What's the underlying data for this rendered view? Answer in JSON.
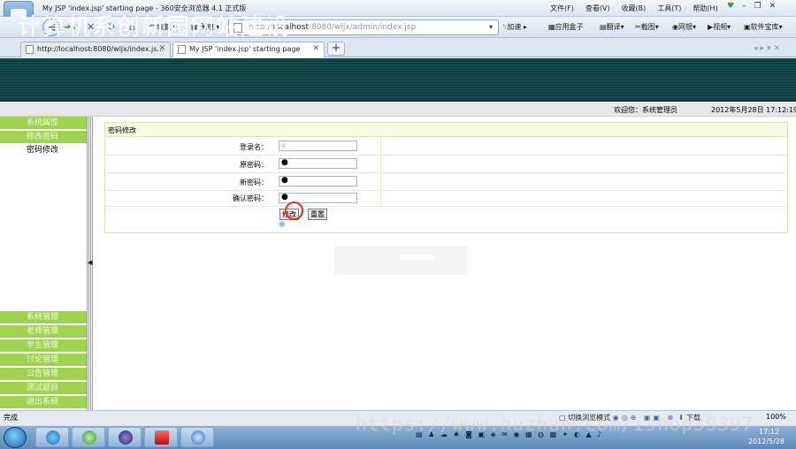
{
  "window": {
    "title": "My JSP 'index.jsp' starting page - 360安全浏览器 4.1 正式版",
    "menus": [
      "文件(F)",
      "查看(V)",
      "收藏(B)",
      "工具(T)",
      "帮助(H)"
    ],
    "controls": [
      "♥",
      "–",
      "❐",
      "✕"
    ]
  },
  "toolbar": {
    "back_icon": "back-arrow-icon",
    "forward_icon": "forward-arrow-icon",
    "restore_label": "恢复",
    "trace_label": "无痕",
    "address": {
      "prefix": "http://",
      "host": "localhost",
      "rest": ":8080/wljx/admin/index.jsp"
    },
    "speedup_label": "加速",
    "extensions": [
      "应用盒子",
      "翻译",
      "截图",
      "网银",
      "视频",
      "软件宝库"
    ]
  },
  "tabs": [
    {
      "label": "http://localhost:8080/wljx/index.js...",
      "active": false
    },
    {
      "label": "My JSP 'index.jsp' starting page",
      "active": true
    }
  ],
  "site": {
    "title": "计算机系创新园网站建设",
    "welcome": "欢迎您：系统管理员",
    "datetime": "2012年5月28日   17:12:19"
  },
  "sidebar": {
    "top_items": [
      {
        "label": "系统属性",
        "style": "green"
      },
      {
        "label": "修改密码",
        "style": "green"
      },
      {
        "label": "密码修改",
        "style": "plain"
      }
    ],
    "bottom_items": [
      {
        "label": "系统管理"
      },
      {
        "label": "老师管理"
      },
      {
        "label": "学生管理"
      },
      {
        "label": "讨论管理"
      },
      {
        "label": "公告管理"
      },
      {
        "label": "测试题目"
      },
      {
        "label": "退出系统"
      }
    ]
  },
  "form": {
    "title": "密码修改",
    "fields": [
      {
        "label": "登录名：",
        "value": "a",
        "kind": "text"
      },
      {
        "label": "原密码：",
        "value": "●",
        "kind": "password"
      },
      {
        "label": "新密码：",
        "value": "●",
        "kind": "password"
      },
      {
        "label": "确认密码：",
        "value": "●",
        "kind": "password"
      }
    ],
    "submit_label": "修改",
    "reset_label": "重置"
  },
  "statusbar": {
    "status": "完成",
    "mode": "切换浏览模式",
    "download": "下载",
    "zoom": "100%"
  },
  "taskbar": {
    "time": "17:12",
    "date": "2012/5/28"
  },
  "watermark": "https://www.huzhan.com/ishop39397",
  "colors": {
    "banner": "#0c3f3f",
    "sidebar_green": "#9fd24f",
    "panel_head": "#f7fbe2",
    "cursor_ring": "#e02a1d"
  }
}
